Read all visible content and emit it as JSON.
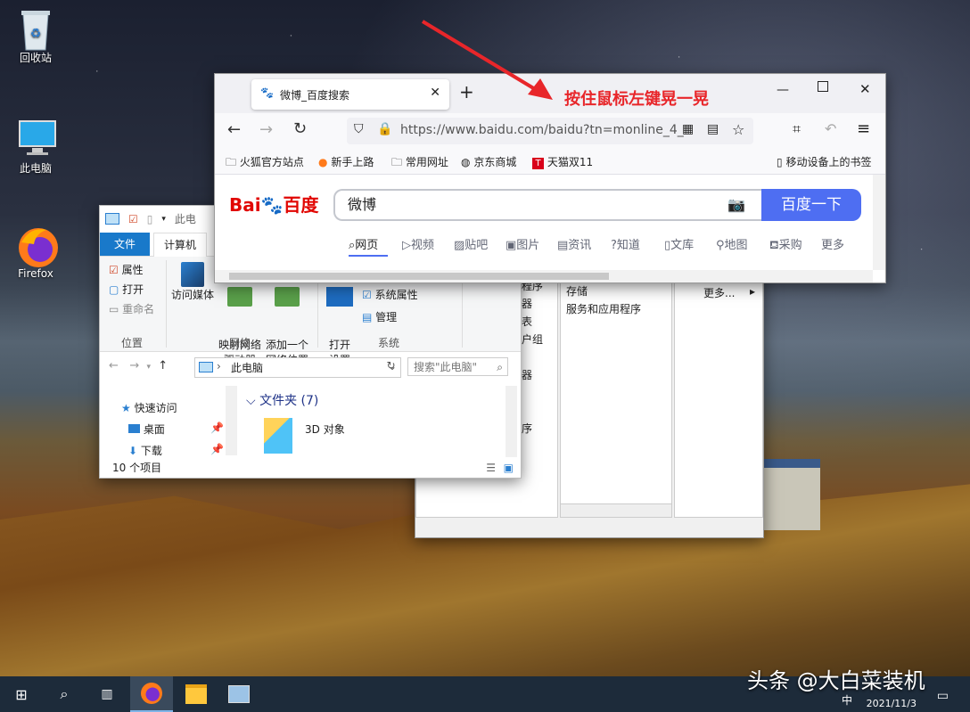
{
  "desktop": {
    "icons": [
      {
        "label": "回收站"
      },
      {
        "label": "此电脑"
      },
      {
        "label": "Firefox"
      }
    ]
  },
  "annotation": {
    "text": "按住鼠标左键晃一晃",
    "color": "#e8262a"
  },
  "firefox": {
    "tab_title": "微博_百度搜索",
    "new_tab": "+",
    "url": "https://www.baidu.com/baidu?tn=monline_4_",
    "bookmarks": [
      "火狐官方站点",
      "新手上路",
      "常用网址",
      "京东商城",
      "天猫双11"
    ],
    "mobile_bookmarks": "移动设备上的书签",
    "baidu": {
      "logo_left": "Bai",
      "logo_right": "百度",
      "query": "微博",
      "search_button": "百度一下",
      "nav": [
        "网页",
        "视频",
        "贴吧",
        "图片",
        "资讯",
        "知道",
        "文库",
        "地图",
        "采购",
        "更多"
      ],
      "accent": "#4e6ef2"
    }
  },
  "explorer": {
    "title_fragment": "此电",
    "tabs": {
      "file": "文件",
      "computer": "计算机"
    },
    "ribbon": {
      "location_items": [
        "属性",
        "打开",
        "重命名"
      ],
      "location_group": "位置",
      "network_items": [
        "访问媒体",
        "映射网络\n驱动器",
        "添加一个\n网络位置"
      ],
      "network_group": "网络",
      "system_items": [
        "打开\n设置",
        "系统属性",
        "管理"
      ],
      "system_group": "系统"
    },
    "address": "此电脑",
    "search_placeholder": "搜索\"此电脑\"",
    "nav": [
      "快速访问",
      "桌面",
      "下载"
    ],
    "section": "文件夹 (7)",
    "folder": "3D 对象",
    "status": "10 个项目"
  },
  "explorer2": {
    "items_left": [
      "程序",
      "器",
      "表",
      "户组",
      "器",
      "序"
    ],
    "items_mid": [
      "存储",
      "服务和应用程序"
    ],
    "items_right": [
      "更多..."
    ]
  },
  "taskbar": {
    "watermark": "头条 @大白菜装机",
    "date": "2021/11/3",
    "ime": "中"
  }
}
